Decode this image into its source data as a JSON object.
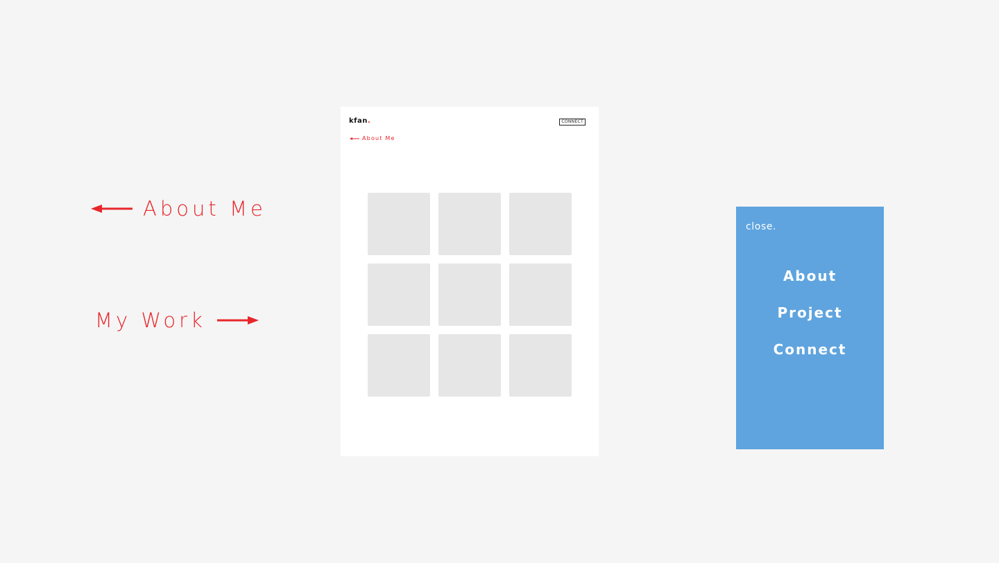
{
  "annotations": {
    "about_label": "About Me",
    "work_label": "My Work"
  },
  "mockup_page": {
    "logo_text": "kfan",
    "logo_dot": ".",
    "connect_label": "CONNECT",
    "about_link_label": "About Me",
    "tiles": [
      "",
      "",
      "",
      "",
      "",
      "",
      "",
      "",
      ""
    ]
  },
  "mobile_menu": {
    "close_label": "close.",
    "items": [
      "About",
      "Project",
      "Connect"
    ]
  },
  "colors": {
    "accent": "#e8262b",
    "menu_background": "#5fa4de",
    "page_background": "#f5f5f5",
    "tile": "#e6e6e6"
  }
}
